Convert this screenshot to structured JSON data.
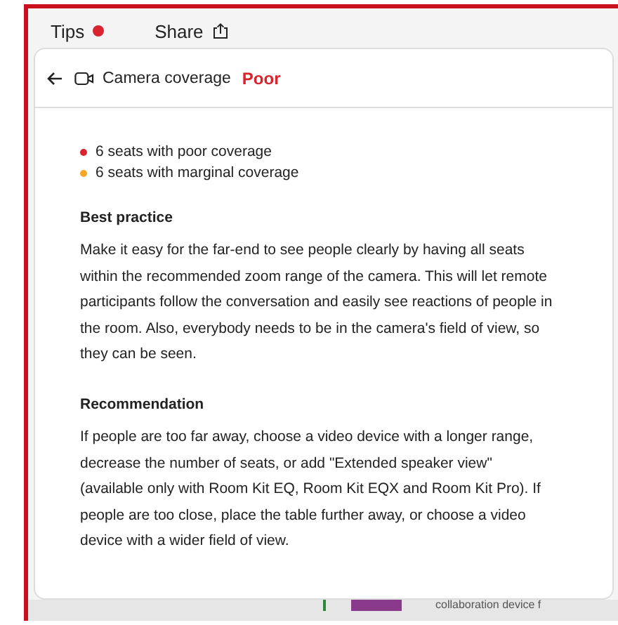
{
  "tabs": [
    {
      "label": "Tips",
      "kind": "dot"
    },
    {
      "label": "Share",
      "kind": "share"
    }
  ],
  "panel": {
    "title": "Camera coverage",
    "status": "Poor",
    "summary": [
      {
        "text": "6 seats with poor coverage",
        "color": "#d9232e"
      },
      {
        "text": "6 seats with marginal coverage",
        "color": "#f5a623"
      }
    ],
    "sections": [
      {
        "heading": "Best practice",
        "body": "Make it easy for the far-end to see people clearly by having all seats within the recommended zoom range of the camera. This will let remote participants follow the conversation and easily see reactions of people in the room. Also, everybody needs to be in the camera's field of view, so they can be seen."
      },
      {
        "heading": "Recommendation",
        "body": "If people are too far away, choose a video device with a longer range, decrease the number of seats, or add \"Extended speaker view\" (available only with Room Kit EQ, Room Kit EQX and Room Kit Pro). If people are too close, place the table further away, or choose a video device with a wider field of view."
      }
    ]
  },
  "background_text": "collaboration device f"
}
